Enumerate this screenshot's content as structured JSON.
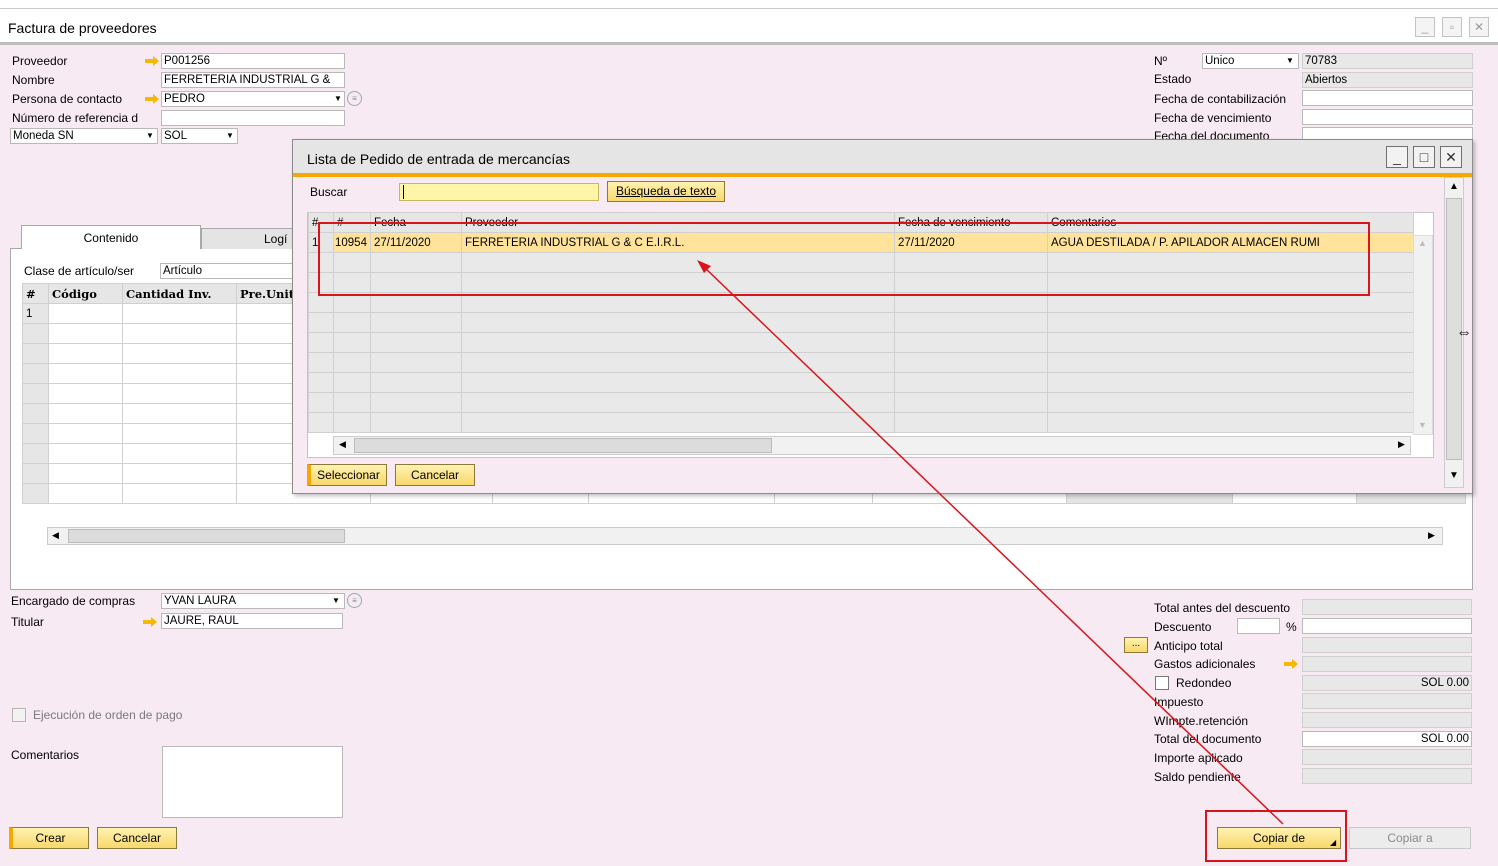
{
  "main_window": {
    "title": "Factura de proveedores"
  },
  "header_left": {
    "proveedor_label": "Proveedor",
    "proveedor_value": "P001256",
    "nombre_label": "Nombre",
    "nombre_value": "FERRETERIA INDUSTRIAL G &",
    "contacto_label": "Persona de contacto",
    "contacto_value": "PEDRO",
    "referencia_label": "Número de referencia d",
    "referencia_value": "",
    "moneda_label": "Moneda SN",
    "moneda_value": "SOL"
  },
  "header_right": {
    "no_label": "Nº",
    "no_series": "Unico",
    "no_value": "70783",
    "estado_label": "Estado",
    "estado_value": "Abiertos",
    "fecha_contab_label": "Fecha de contabilización",
    "fecha_venc_label": "Fecha de vencimiento",
    "fecha_doc_label": "Fecha del documento"
  },
  "tabs": {
    "contenido": "Contenido",
    "logistica": "Logí"
  },
  "content": {
    "clase_label": "Clase de artículo/ser",
    "clase_value": "Artículo",
    "columns": [
      "#",
      "Código",
      "Cantidad Inv.",
      "Pre.Unit"
    ],
    "first_row_index": "1"
  },
  "footer_left": {
    "encargado_label": "Encargado de compras",
    "encargado_value": "YVAN LAURA",
    "titular_label": "Titular",
    "titular_value": "JAURE, RAUL",
    "ejecucion_label": "Ejecución de orden de pago",
    "comentarios_label": "Comentarios",
    "crear_btn": "Crear",
    "cancelar_btn": "Cancelar"
  },
  "footer_right": {
    "total_antes_label": "Total antes del descuento",
    "descuento_label": "Descuento",
    "pct": "%",
    "anticipo_label": "Anticipo total",
    "ellipsis": "...",
    "gastos_label": "Gastos adicionales",
    "redondeo_label": "Redondeo",
    "redondeo_value": "SOL 0.00",
    "impuesto_label": "Impuesto",
    "wimpte_label": "WImpte.retención",
    "total_doc_label": "Total del documento",
    "total_doc_value": "SOL 0.00",
    "importe_label": "Importe aplicado",
    "saldo_label": "Saldo pendiente",
    "copiar_de_btn": "Copiar de",
    "copiar_a_btn": "Copiar a"
  },
  "dialog": {
    "title": "Lista de Pedido de entrada de mercancías",
    "buscar_label": "Buscar",
    "buscar_value": "",
    "busqueda_btn": "Búsqueda de texto",
    "columns": [
      "#",
      "#",
      "Fecha",
      "Proveedor",
      "Fecha de vencimiento",
      "Comentarios"
    ],
    "rows": [
      {
        "idx": "1",
        "num": "10954",
        "fecha": "27/11/2020",
        "proveedor": "FERRETERIA INDUSTRIAL G & C E.I.R.L.",
        "venc": "27/11/2020",
        "comentarios": "AGUA DESTILADA / P. APILADOR ALMACEN RUMI"
      }
    ],
    "seleccionar_btn": "Seleccionar",
    "cancelar_btn": "Cancelar"
  },
  "colors": {
    "accent": "#f6a800",
    "highlight": "#ffe39a",
    "annotation": "#d9141b",
    "panel": "#f8eaf3"
  }
}
